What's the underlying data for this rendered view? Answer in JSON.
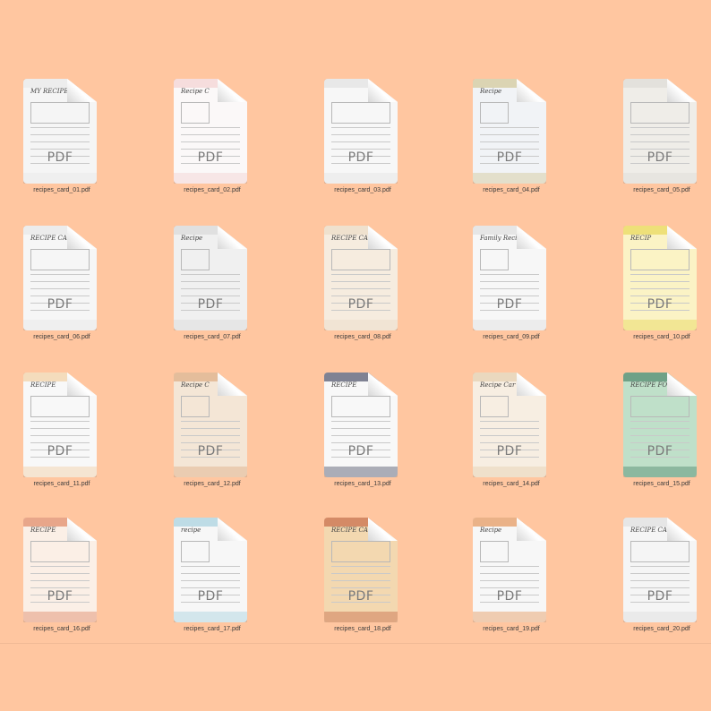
{
  "icon_label": "PDF",
  "files": [
    {
      "name": "recipes_card_01.pdf",
      "header": "MY RECIPE",
      "accent": "#e6e6e6",
      "paper": "#f5f5f5"
    },
    {
      "name": "recipes_card_02.pdf",
      "header": "Recipe C",
      "accent": "#f2c7c7",
      "paper": "#fbf8f8"
    },
    {
      "name": "recipes_card_03.pdf",
      "header": "",
      "accent": "#dcdcdc",
      "paper": "#f7f7f7"
    },
    {
      "name": "recipes_card_04.pdf",
      "header": "Recipe",
      "accent": "#c8b97b",
      "paper": "#f1f3f6"
    },
    {
      "name": "recipes_card_05.pdf",
      "header": "",
      "accent": "#d9d7d2",
      "paper": "#efede8"
    },
    {
      "name": "recipes_card_06.pdf",
      "header": "RECIPE CAR",
      "accent": "#e3e3e3",
      "paper": "#f6f6f6"
    },
    {
      "name": "recipes_card_07.pdf",
      "header": "Recipe",
      "accent": "#d4d4d4",
      "paper": "#f0f0f0"
    },
    {
      "name": "recipes_card_08.pdf",
      "header": "RECIPE CARD",
      "accent": "#e9d8bf",
      "paper": "#f6ecdf"
    },
    {
      "name": "recipes_card_09.pdf",
      "header": "Family Recipe",
      "accent": "#d8d8d8",
      "paper": "#f7f7f7"
    },
    {
      "name": "recipes_card_10.pdf",
      "header": "RECIP",
      "accent": "#e3cf3a",
      "paper": "#fbf3c5"
    },
    {
      "name": "recipes_card_11.pdf",
      "header": "RECIPE",
      "accent": "#f0c48b",
      "paper": "#f8f8f8"
    },
    {
      "name": "recipes_card_12.pdf",
      "header": "Recipe C",
      "accent": "#d79a6c",
      "paper": "#f4e6d6"
    },
    {
      "name": "recipes_card_13.pdf",
      "header": "RECIPE",
      "accent": "#1c2140",
      "paper": "#f8f8f8"
    },
    {
      "name": "recipes_card_14.pdf",
      "header": "Recipe Car",
      "accent": "#e0c7a1",
      "paper": "#f7eee2"
    },
    {
      "name": "recipes_card_15.pdf",
      "header": "RECIPE FOR",
      "accent": "#2d6e51",
      "paper": "#bfe0c9"
    },
    {
      "name": "recipes_card_16.pdf",
      "header": "RECIPE",
      "accent": "#d86a3e",
      "paper": "#fbefe6"
    },
    {
      "name": "recipes_card_17.pdf",
      "header": "recipe",
      "accent": "#8fc7d8",
      "paper": "#f7f7f7"
    },
    {
      "name": "recipes_card_18.pdf",
      "header": "RECIPE CAR",
      "accent": "#b94a2a",
      "paper": "#f3d8b0"
    },
    {
      "name": "recipes_card_19.pdf",
      "header": "Recipe",
      "accent": "#e07a2e",
      "paper": "#f7f7f7"
    },
    {
      "name": "recipes_card_20.pdf",
      "header": "RECIPE CA",
      "accent": "#d8d8d8",
      "paper": "#f5f5f5"
    }
  ]
}
